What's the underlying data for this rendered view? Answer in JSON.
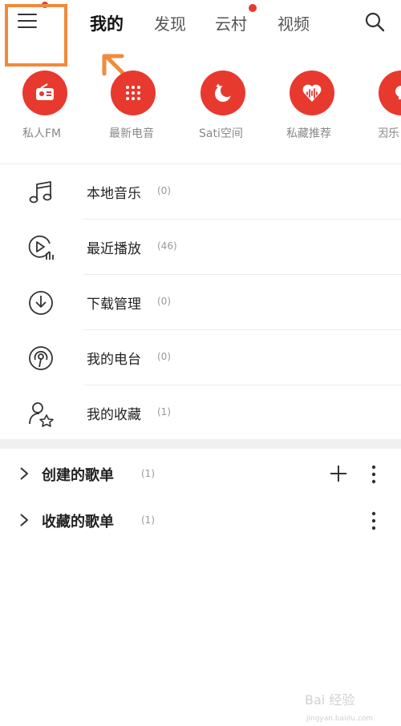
{
  "header": {
    "tabs": [
      {
        "label": "我的",
        "active": true
      },
      {
        "label": "发现",
        "active": false
      },
      {
        "label": "云村",
        "active": false,
        "badge": true
      },
      {
        "label": "视频",
        "active": false
      }
    ],
    "menu_icon": "hamburger-menu-icon",
    "search_icon": "search-icon"
  },
  "quick_actions": [
    {
      "label": "私人FM",
      "icon": "radio-icon"
    },
    {
      "label": "最新电音",
      "icon": "dots-grid-icon"
    },
    {
      "label": "Sati空间",
      "icon": "moon-icon"
    },
    {
      "label": "私藏推荐",
      "icon": "heart-wave-icon"
    },
    {
      "label": "因乐",
      "icon": "bulb-icon"
    }
  ],
  "library": [
    {
      "label": "本地音乐",
      "count": "(0)",
      "icon": "music-note-icon"
    },
    {
      "label": "最近播放",
      "count": "(46)",
      "icon": "recent-play-icon"
    },
    {
      "label": "下载管理",
      "count": "(0)",
      "icon": "download-icon"
    },
    {
      "label": "我的电台",
      "count": "(0)",
      "icon": "podcast-icon"
    },
    {
      "label": "我的收藏",
      "count": "(1)",
      "icon": "user-star-icon"
    }
  ],
  "playlists": [
    {
      "label": "创建的歌单",
      "count": "(1)",
      "has_add": true
    },
    {
      "label": "收藏的歌单",
      "count": "(1)",
      "has_add": false
    }
  ],
  "watermark": {
    "brand": "Bai 经验",
    "url": "jingyan.baidu.com"
  },
  "colors": {
    "accent": "#e8392f",
    "highlight": "#f08a3a"
  }
}
